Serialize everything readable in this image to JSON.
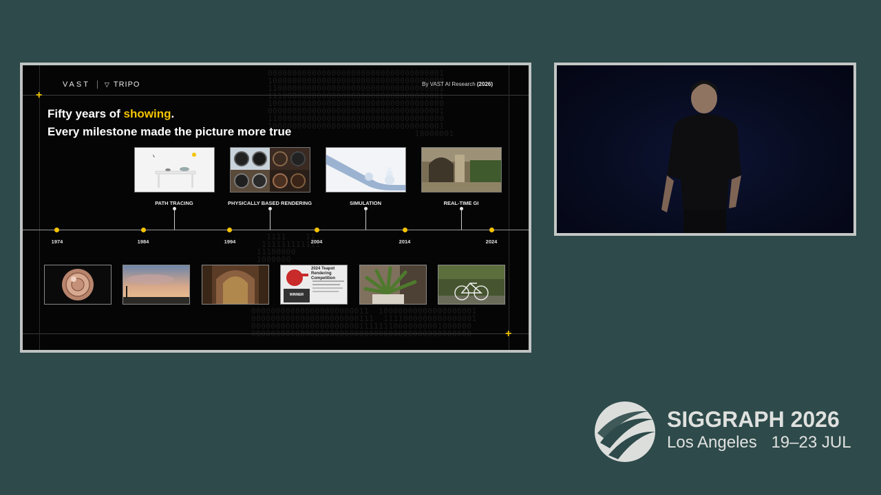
{
  "slide": {
    "brand": "VAST",
    "brand2": "TRIPO",
    "byline": "By VAST AI Research",
    "byline_year": "(2026)",
    "headline_line1_a": "Fifty years of ",
    "headline_line1_highlight": "showing",
    "headline_line1_b": ".",
    "headline_line2": "Every milestone made the picture more true",
    "milestones": [
      {
        "label": "PATH TRACING"
      },
      {
        "label": "PHYSICALLY BASED RENDERING"
      },
      {
        "label": "SIMULATION"
      },
      {
        "label": "REAL-TIME GI"
      }
    ],
    "years": [
      "1974",
      "1984",
      "1994",
      "2004",
      "2014",
      "2024"
    ],
    "teapot_card": {
      "title": "2024 Teapot Rendering Competition",
      "badge": "WINNER"
    }
  },
  "event": {
    "title": "SIGGRAPH 2026",
    "location": "Los Angeles",
    "dates": "19–23 JUL"
  },
  "colors": {
    "accent": "#f5c400",
    "background": "#2e4a4a",
    "slide_bg": "#050505"
  }
}
